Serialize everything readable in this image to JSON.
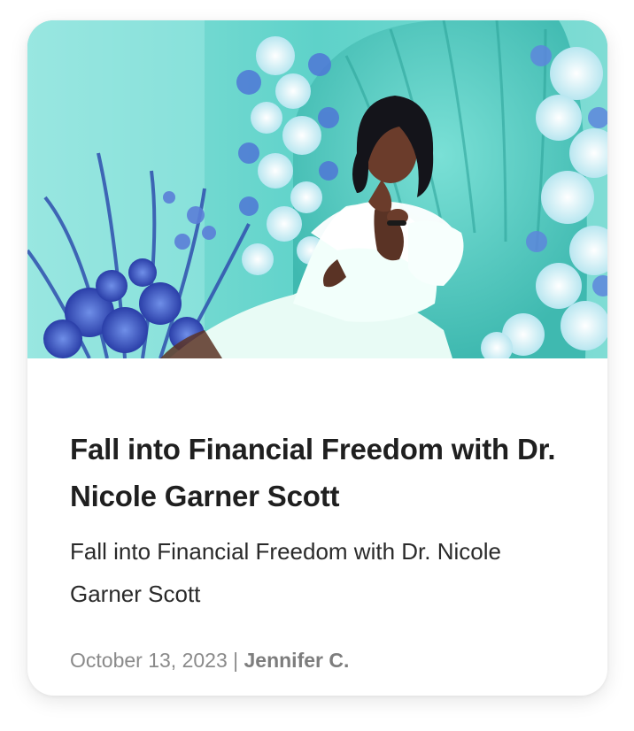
{
  "post": {
    "image_alt": "Woman in white off-shoulder dress seated on a teal throne surrounded by blue and white flowers",
    "title": "Fall into Financial Freedom with Dr. Nicole Garner Scott",
    "excerpt": "Fall into Financial Freedom with Dr. Nicole Garner Scott",
    "date": "October 13, 2023",
    "separator": " | ",
    "author": "Jennifer C."
  },
  "colors": {
    "title": "#1f1f1f",
    "excerpt": "#2a2a2a",
    "meta": "#8a8a8a",
    "hero_teal": "#5fd6cf"
  }
}
